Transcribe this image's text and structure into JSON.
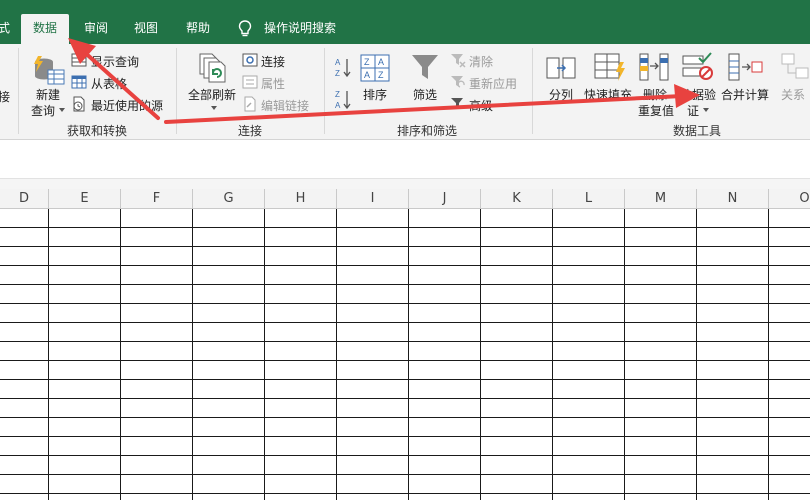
{
  "tabs": [
    {
      "label": "式"
    },
    {
      "label": "数据"
    },
    {
      "label": "审阅"
    },
    {
      "label": "视图"
    },
    {
      "label": "帮助"
    },
    {
      "label": "操作说明搜索"
    }
  ],
  "ribbon": {
    "get_transform": {
      "partial_left_label": "接",
      "new_query": [
        "新建",
        "查询"
      ],
      "show_queries": "显示查询",
      "from_table": "从表格",
      "recent_sources": "最近使用的源",
      "group_label": "获取和转换"
    },
    "connections": {
      "refresh_all": "全部刷新",
      "connections": "连接",
      "properties": "属性",
      "edit_links": "编辑链接",
      "group_label": "连接"
    },
    "sort_filter": {
      "sort": "排序",
      "filter": "筛选",
      "clear": "清除",
      "reapply": "重新应用",
      "advanced": "高级",
      "group_label": "排序和筛选"
    },
    "data_tools": {
      "text_to_columns": "分列",
      "flash_fill": "快速填充",
      "remove_duplicates": [
        "删除",
        "重复值"
      ],
      "data_validation": [
        "数据验",
        "证"
      ],
      "consolidate": "合并计算",
      "relationships": "关系",
      "group_label": "数据工具"
    }
  },
  "columns": [
    "D",
    "E",
    "F",
    "G",
    "H",
    "I",
    "J",
    "K",
    "L",
    "M",
    "N",
    "O"
  ],
  "colors": {
    "accent": "#217346",
    "arrow": "#e8423f"
  }
}
